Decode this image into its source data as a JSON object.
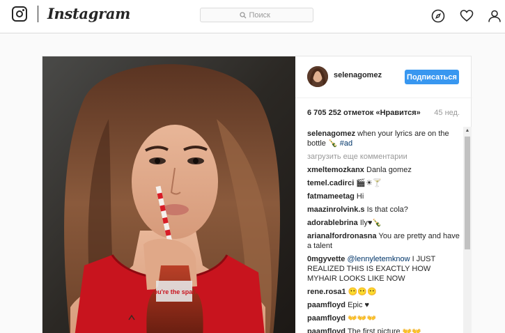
{
  "header": {
    "wordmark": "Instagram",
    "search_placeholder": "Поиск",
    "icons": [
      "instagram-logo-icon",
      "search-icon",
      "compass-icon",
      "heart-icon",
      "profile-icon"
    ]
  },
  "post": {
    "author": "selenagomez",
    "follow_label": "Подписаться",
    "likes": "6 705 252 отметок «Нравится»",
    "age": "45 нед.",
    "caption": {
      "user": "selenagomez",
      "text": "when your lyrics are on the bottle",
      "emoji": "🍾",
      "hashtag": "#ad"
    },
    "load_more": "загрузить еще комментарии",
    "comments": [
      {
        "user": "xmeltemozkanx",
        "text": "Danla gomez"
      },
      {
        "user": "temel.cadirci",
        "text": "🎬☀🍸"
      },
      {
        "user": "fatmameetag",
        "text": "Hi"
      },
      {
        "user": "maazinrolvink.s",
        "text": "Is that cola?"
      },
      {
        "user": "adorablebrina",
        "text": "Ily♥🍾"
      },
      {
        "user": "arianalfordronasna",
        "text": "You are pretty and have a talent"
      },
      {
        "user": "0mgyvette",
        "mention": "@lennyletemknow",
        "text": "I JUST REALIZED THIS IS EXACTLY HOW MYHAIR LOOKS LIKE NOW"
      },
      {
        "user": "rene.rosa1",
        "text": "😶😶😶"
      },
      {
        "user": "paamfloyd",
        "text": "Epic ♥"
      },
      {
        "user": "paamfloyd",
        "text": "👐👐👐"
      },
      {
        "user": "paamfloyd",
        "text": "The first picture 👐👐"
      }
    ],
    "bottle_label": "You're the spark"
  },
  "colors": {
    "accent": "#3897f0",
    "link": "#003569",
    "muted": "#999999",
    "dress": "#c8141e"
  }
}
